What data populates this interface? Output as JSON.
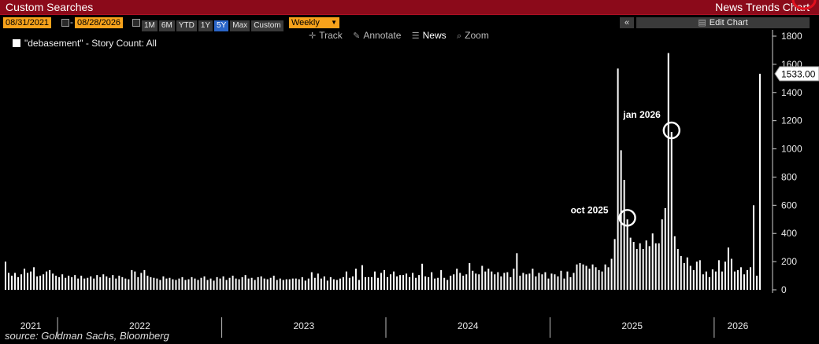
{
  "window": {
    "left_title": "Custom Searches",
    "right_title": "News Trends Chart"
  },
  "toolbar": {
    "start_date": "08/31/2021",
    "end_date": "08/28/2026",
    "date_separator": "-",
    "periods": [
      "1M",
      "6M",
      "YTD",
      "1Y",
      "5Y",
      "Max",
      "Custom"
    ],
    "active_period": "5Y",
    "frequency": "Weekly",
    "collapse_label": "«",
    "edit_chart_label": "Edit Chart"
  },
  "chart_tools": {
    "track": "Track",
    "annotate": "Annotate",
    "news": "News",
    "zoom": "Zoom"
  },
  "legend": {
    "label": "\"debasement\" - Story Count: All"
  },
  "source": "source: Goldman Sachs, Bloomberg",
  "colors": {
    "title_bar": "#8b0a1a",
    "accent_orange": "#f7a21b",
    "active_blue": "#2a65c8",
    "bars": "#ffffff",
    "highlight_ring": "#e0101e"
  },
  "chart_data": {
    "type": "bar",
    "title": "",
    "xlabel": "",
    "ylabel": "",
    "y_axis_side": "right",
    "ylim": [
      0,
      1800
    ],
    "y_ticks": [
      0,
      200,
      400,
      600,
      800,
      1000,
      1200,
      1400,
      1600,
      1800
    ],
    "x_year_labels": [
      "2021",
      "2022",
      "2023",
      "2024",
      "2025",
      "2026"
    ],
    "grid": false,
    "last_value_label": "1533.00",
    "series": [
      {
        "name": "\"debasement\"",
        "values": [
          200,
          120,
          100,
          120,
          90,
          110,
          150,
          120,
          130,
          160,
          95,
          100,
          110,
          130,
          140,
          115,
          100,
          90,
          110,
          85,
          100,
          90,
          105,
          80,
          100,
          80,
          85,
          95,
          80,
          105,
          90,
          110,
          95,
          85,
          105,
          80,
          100,
          90,
          80,
          75,
          140,
          130,
          90,
          120,
          140,
          100,
          90,
          85,
          80,
          70,
          95,
          80,
          85,
          75,
          70,
          80,
          90,
          70,
          75,
          90,
          80,
          70,
          85,
          95,
          70,
          80,
          65,
          90,
          80,
          95,
          70,
          85,
          100,
          80,
          75,
          90,
          105,
          80,
          85,
          70,
          90,
          95,
          80,
          75,
          85,
          100,
          70,
          80,
          70,
          75,
          75,
          80,
          80,
          75,
          90,
          65,
          80,
          125,
          85,
          115,
          80,
          95,
          65,
          90,
          75,
          70,
          80,
          90,
          130,
          85,
          95,
          150,
          70,
          175,
          90,
          90,
          90,
          130,
          85,
          120,
          140,
          90,
          110,
          130,
          95,
          105,
          105,
          115,
          90,
          120,
          85,
          105,
          185,
          95,
          90,
          125,
          80,
          85,
          140,
          85,
          70,
          100,
          110,
          150,
          120,
          100,
          110,
          190,
          135,
          115,
          110,
          170,
          130,
          150,
          130,
          110,
          125,
          95,
          120,
          125,
          90,
          150,
          260,
          100,
          120,
          110,
          115,
          150,
          95,
          120,
          110,
          125,
          80,
          115,
          110,
          95,
          135,
          80,
          130,
          90,
          120,
          180,
          190,
          180,
          170,
          150,
          180,
          160,
          140,
          130,
          180,
          160,
          220,
          360,
          1570,
          990,
          780,
          500,
          370,
          340,
          290,
          330,
          290,
          350,
          310,
          400,
          330,
          330,
          500,
          580,
          1680,
          1120,
          380,
          290,
          240,
          190,
          230,
          170,
          140,
          200,
          210,
          110,
          130,
          90,
          145,
          130,
          210,
          130,
          200,
          300,
          220,
          130,
          140,
          160,
          110,
          140,
          160,
          600,
          100,
          1533
        ]
      }
    ],
    "annotations": [
      {
        "label": "oct 2025",
        "index": 197,
        "ring_color": "#ffffff"
      },
      {
        "label": "jan 2026",
        "index": 211,
        "ring_color": "#ffffff"
      },
      {
        "label": "\"debasement\"",
        "index": 253,
        "ring_color": "#e0101e"
      }
    ]
  }
}
